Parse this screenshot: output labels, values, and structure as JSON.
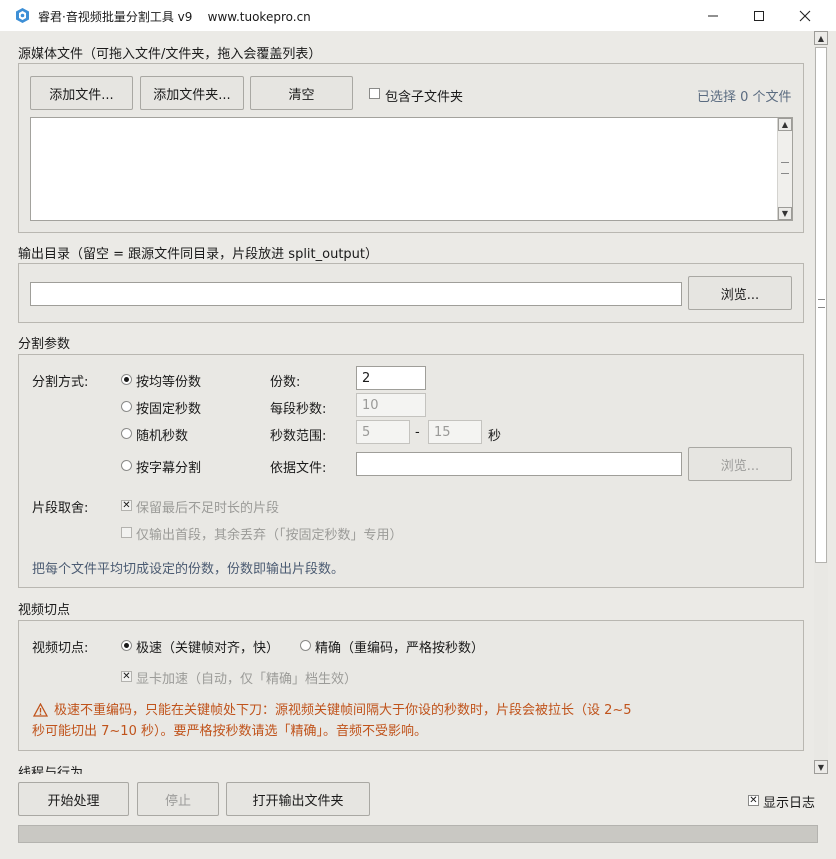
{
  "window": {
    "title": "睿君·音视频批量分割工具 v9    www.tuokepro.cn",
    "minimize_icon": "minimize-icon",
    "maximize_icon": "maximize-icon",
    "close_icon": "close-icon"
  },
  "source": {
    "group_title": "源媒体文件（可拖入文件/文件夹，拖入会覆盖列表）",
    "add_files_label": "添加文件...",
    "add_folder_label": "添加文件夹...",
    "clear_label": "清空",
    "include_subfolders_label": "包含子文件夹",
    "include_subfolders_checked": false,
    "selected_count_text": "已选择 0 个文件"
  },
  "output": {
    "group_title": "输出目录（留空 = 跟源文件同目录，片段放进 split_output）",
    "path_value": "",
    "browse_label": "浏览..."
  },
  "split": {
    "group_title": "分割参数",
    "method_label": "分割方式:",
    "methods": [
      {
        "label": "按均等份数",
        "selected": true
      },
      {
        "label": "按固定秒数",
        "selected": false
      },
      {
        "label": "随机秒数",
        "selected": false
      },
      {
        "label": "按字幕分割",
        "selected": false
      }
    ],
    "parts_label": "份数:",
    "parts_value": "2",
    "seconds_label": "每段秒数:",
    "seconds_value": "10",
    "range_label": "秒数范围:",
    "range_min": "5",
    "range_dash": "-",
    "range_max": "15",
    "range_unit": "秒",
    "subtitle_file_label": "依据文件:",
    "subtitle_file_value": "",
    "subtitle_browse_label": "浏览...",
    "keep_label": "片段取舍:",
    "keep_last_label": "保留最后不足时长的片段",
    "keep_last_checked": true,
    "first_only_label": "仅输出首段，其余丢弃（「按固定秒数」专用）",
    "first_only_checked": false,
    "hint": "把每个文件平均切成设定的份数，份数即输出片段数。"
  },
  "video": {
    "group_title": "视频切点",
    "cut_label": "视频切点:",
    "modes": [
      {
        "label": "极速（关键帧对齐，快）",
        "selected": true
      },
      {
        "label": "精确（重编码，严格按秒数）",
        "selected": false
      }
    ],
    "gpu_label": "显卡加速（自动，仅「精确」档生效）",
    "gpu_checked": true,
    "warning_line1": "极速不重编码，只能在关键帧处下刀：源视频关键帧间隔大于你设的秒数时，片段会被拉长（设 2~5",
    "warning_line2": "秒可能切出 7~10 秒）。要严格按秒数请选「精确」。音频不受影响。",
    "warning_icon": "warning-icon",
    "warning_color": "#c0531b"
  },
  "threads": {
    "group_title": "线程与行为"
  },
  "bottom": {
    "start_label": "开始处理",
    "stop_label": "停止",
    "open_output_label": "打开输出文件夹",
    "show_log_label": "显示日志",
    "show_log_checked": true
  }
}
